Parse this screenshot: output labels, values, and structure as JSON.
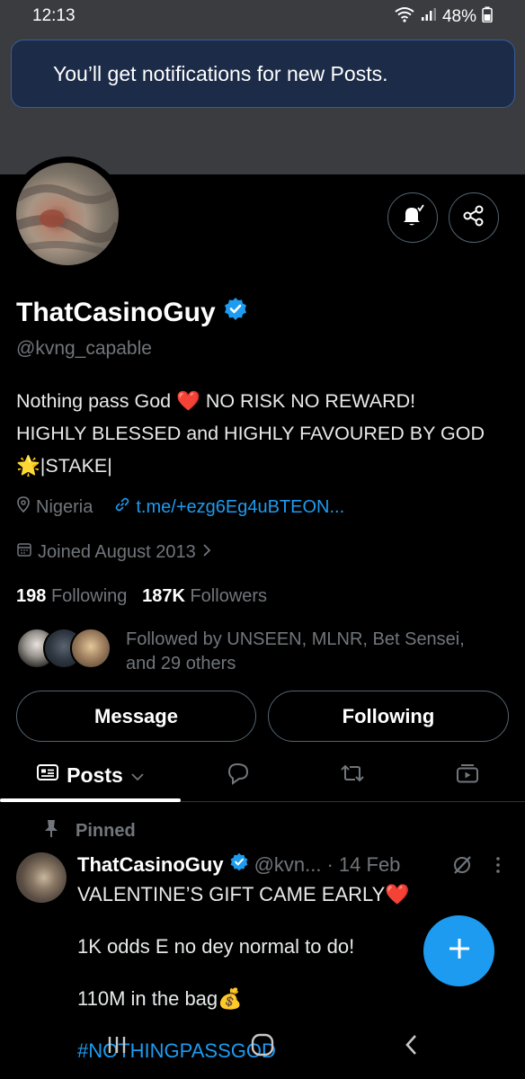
{
  "status": {
    "time": "12:13",
    "battery": "48%"
  },
  "toast": {
    "message": "You’ll get notifications for new Posts."
  },
  "profile": {
    "name": "ThatCasinoGuy",
    "handle": "@kvng_capable",
    "bio_line1": "Nothing pass God ❤️ NO RISK NO REWARD!",
    "bio_line2": "HIGHLY BLESSED and HIGHLY FAVOURED BY GOD",
    "bio_line3": "🌟|STAKE|",
    "location": "Nigeria",
    "link": "t.me/+ezg6Eg4uBTEON...",
    "joined": "Joined August 2013",
    "following_count": "198",
    "following_label": "Following",
    "followers_count": "187K",
    "followers_label": "Followers",
    "followed_by_line1": "Followed by UNSEEN, MLNR, Bet Sensei,",
    "followed_by_line2": "and 29 others"
  },
  "actions": {
    "message": "Message",
    "following": "Following"
  },
  "tabs": {
    "posts": "Posts"
  },
  "post": {
    "pinned_label": "Pinned",
    "author": "ThatCasinoGuy",
    "handle": "@kvn...",
    "date": "· 14 Feb",
    "line1": "VALENTINE’S GIFT CAME EARLY❤️",
    "line2": "1K odds E no dey normal to do!",
    "line3": "110M in the bag💰",
    "hashtag": "#NOTHINGPASSGOD"
  },
  "colors": {
    "accent": "#1d9bf0",
    "toast_bg": "#1c2b48",
    "muted": "#71767b"
  },
  "icons": [
    "wifi-icon",
    "signal-icon",
    "battery-icon",
    "bell-icon",
    "share-icon",
    "verified-icon",
    "location-icon",
    "link-icon",
    "calendar-icon",
    "chevron-right-icon",
    "posts-icon",
    "chevron-down-icon",
    "reply-icon",
    "retweet-icon",
    "media-icon",
    "pin-icon",
    "grok-icon",
    "more-icon",
    "plus-icon",
    "recents-icon",
    "home-icon",
    "back-icon"
  ]
}
